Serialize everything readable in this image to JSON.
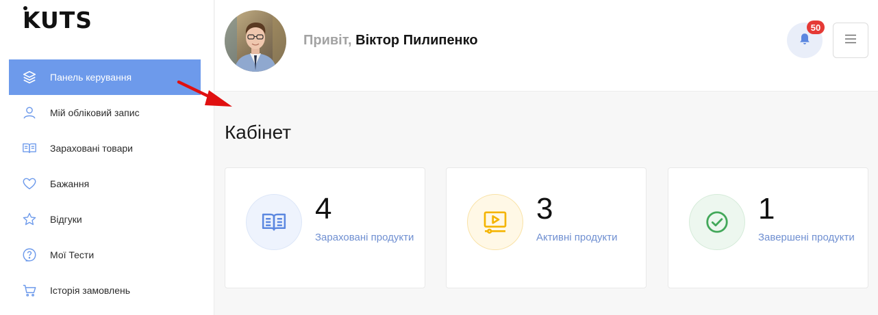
{
  "brand": {
    "logo_text": "KUTS"
  },
  "sidebar": {
    "items": [
      {
        "label": "Панель керування",
        "icon": "layers-icon",
        "active": true
      },
      {
        "label": "Мій обліковий запис",
        "icon": "user-icon",
        "active": false
      },
      {
        "label": "Зараховані товари",
        "icon": "book-open-icon",
        "active": false
      },
      {
        "label": "Бажання",
        "icon": "heart-icon",
        "active": false
      },
      {
        "label": "Відгуки",
        "icon": "star-icon",
        "active": false
      },
      {
        "label": "Мої Тести",
        "icon": "question-circle-icon",
        "active": false
      },
      {
        "label": "Історія замовлень",
        "icon": "cart-icon",
        "active": false
      }
    ]
  },
  "header": {
    "greeting_prefix": "Привіт,",
    "user_name": "Віктор Пилипенко",
    "notifications_count": "50"
  },
  "main": {
    "title": "Кабінет",
    "cards": [
      {
        "value": "4",
        "label": "Зараховані продукти",
        "icon": "book-open-icon",
        "color": "#5b87e0",
        "bg": "#eef3fd"
      },
      {
        "value": "3",
        "label": "Активні продукти",
        "icon": "video-play-icon",
        "color": "#f4b400",
        "bg": "#fff8e6"
      },
      {
        "value": "1",
        "label": "Завершені продукти",
        "icon": "check-circle-icon",
        "color": "#43a85a",
        "bg": "#edf7ef"
      }
    ]
  },
  "colors": {
    "accent": "#6d9aeb",
    "badge": "#e53935",
    "link": "#6f8fd1"
  }
}
